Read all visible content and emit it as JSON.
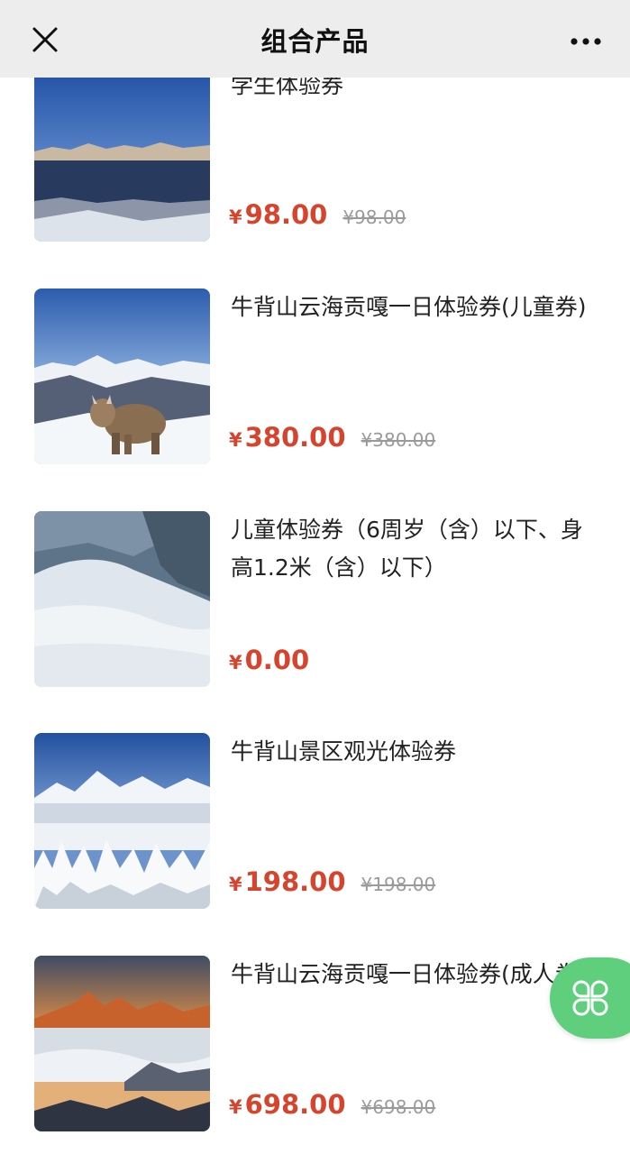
{
  "nav": {
    "title": "组合产品",
    "close_icon": "close-icon",
    "more_icon": "more-dots-icon"
  },
  "products": [
    {
      "name": "学生体验券",
      "currency": "¥",
      "price": "98.00",
      "original_price": "¥98.00"
    },
    {
      "name": "牛背山云海贡嘎一日体验券(儿童券)",
      "currency": "¥",
      "price": "380.00",
      "original_price": "¥380.00"
    },
    {
      "name": "儿童体验券（6周岁（含）以下、身高1.2米（含）以下）",
      "currency": "¥",
      "price": "0.00",
      "original_price": ""
    },
    {
      "name": "牛背山景区观光体验券",
      "currency": "¥",
      "price": "198.00",
      "original_price": "¥198.00"
    },
    {
      "name": "牛背山云海贡嘎一日体验券(成人券)",
      "currency": "¥",
      "price": "698.00",
      "original_price": "¥698.00"
    }
  ],
  "floating_button": {
    "icon": "four-leaf-clover-icon",
    "color": "#5fcf7d"
  },
  "colors": {
    "price": "#d6442d",
    "navbar_bg": "#ededed"
  }
}
